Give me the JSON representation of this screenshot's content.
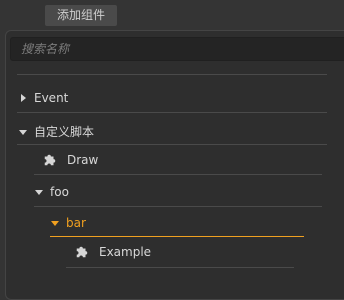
{
  "tab": {
    "label": "添加组件"
  },
  "search": {
    "placeholder": "搜索名称",
    "value": ""
  },
  "tree": {
    "event": {
      "label": "Event",
      "expanded": false
    },
    "custom_scripts": {
      "label": "自定义脚本",
      "expanded": true,
      "items": {
        "draw": {
          "label": "Draw",
          "icon": "puzzle-icon"
        },
        "foo": {
          "label": "foo",
          "expanded": true,
          "bar": {
            "label": "bar",
            "expanded": true,
            "selected": true,
            "items": {
              "example": {
                "label": "Example",
                "icon": "puzzle-icon"
              }
            }
          }
        }
      }
    }
  },
  "colors": {
    "background": "#343434",
    "panel": "#2e2e2e",
    "text": "#d8d8d8",
    "accent": "#f0a020",
    "divider": "#4a4a4a"
  }
}
